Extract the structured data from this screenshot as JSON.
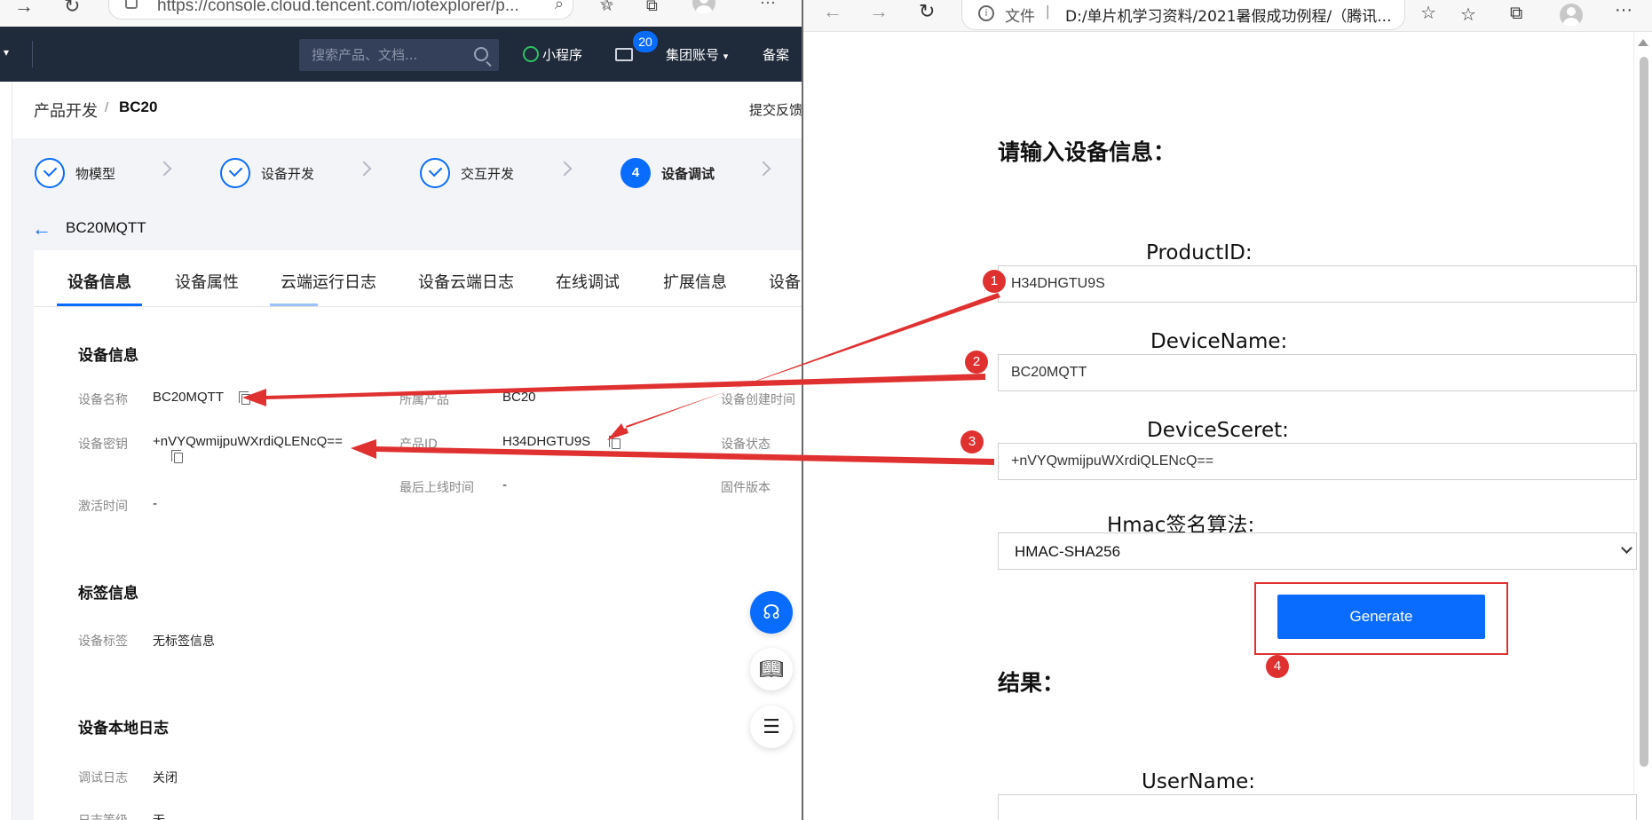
{
  "left_window": {
    "address_url": "https://console.cloud.tencent.com/iotexplorer/p...",
    "search_placeholder": "搜索产品、文档...",
    "nav_mini": "小程序",
    "nav_badge": "20",
    "nav_account": "集团账号",
    "nav_record": "备案",
    "breadcrumb_parent": "产品开发",
    "breadcrumb_sep": "/",
    "breadcrumb_current": "BC20",
    "feedback": "提交反馈",
    "steps": [
      {
        "label": "物模型",
        "state": "done"
      },
      {
        "label": "设备开发",
        "state": "done"
      },
      {
        "label": "交互开发",
        "state": "done"
      },
      {
        "label": "设备调试",
        "state": "active",
        "num": "4"
      }
    ],
    "device_title": "BC20MQTT",
    "tabs": [
      "设备信息",
      "设备属性",
      "云端运行日志",
      "设备云端日志",
      "在线调试",
      "扩展信息",
      "设备"
    ],
    "section_device_info": "设备信息",
    "fields": {
      "device_name_label": "设备名称",
      "device_name_value": "BC20MQTT",
      "product_label": "所属产品",
      "product_value": "BC20",
      "created_label": "设备创建时间",
      "secret_label": "设备密钥",
      "secret_value": "+nVYQwmijpuWXrdiQLENcQ==",
      "product_id_label": "产品ID",
      "product_id_value": "H34DHGTU9S",
      "status_label": "设备状态",
      "last_online_label": "最后上线时间",
      "last_online_value": "-",
      "firmware_label": "固件版本",
      "activated_label": "激活时间",
      "activated_value": "-"
    },
    "section_tags": "标签信息",
    "tag_label": "设备标签",
    "tag_value": "无标签信息",
    "section_local_log": "设备本地日志",
    "debug_log_label": "调试日志",
    "debug_log_value": "关闭",
    "log_level_label": "日志等级",
    "log_level_value": "无"
  },
  "right_window": {
    "address_file": "文件",
    "address_sep": "|",
    "address_path": "D:/单片机学习资料/2021暑假成功例程/（腾讯...",
    "heading": "请输入设备信息：",
    "product_id_label": "ProductID:",
    "product_id_value": "H34DHGTU9S",
    "device_name_label": "DeviceName:",
    "device_name_value": "BC20MQTT",
    "device_secret_label": "DeviceSceret:",
    "device_secret_value": "+nVYQwmijpuWXrdiQLENcQ==",
    "hmac_label": "Hmac签名算法:",
    "hmac_value": "HMAC-SHA256",
    "generate_label": "Generate",
    "result_heading": "结果：",
    "username_label": "UserName:"
  },
  "annotations": {
    "markers": [
      "1",
      "2",
      "3",
      "4"
    ],
    "color": "#e03131"
  },
  "colors": {
    "nav_bg": "#1f2a3a",
    "accent": "#0a6cff"
  }
}
